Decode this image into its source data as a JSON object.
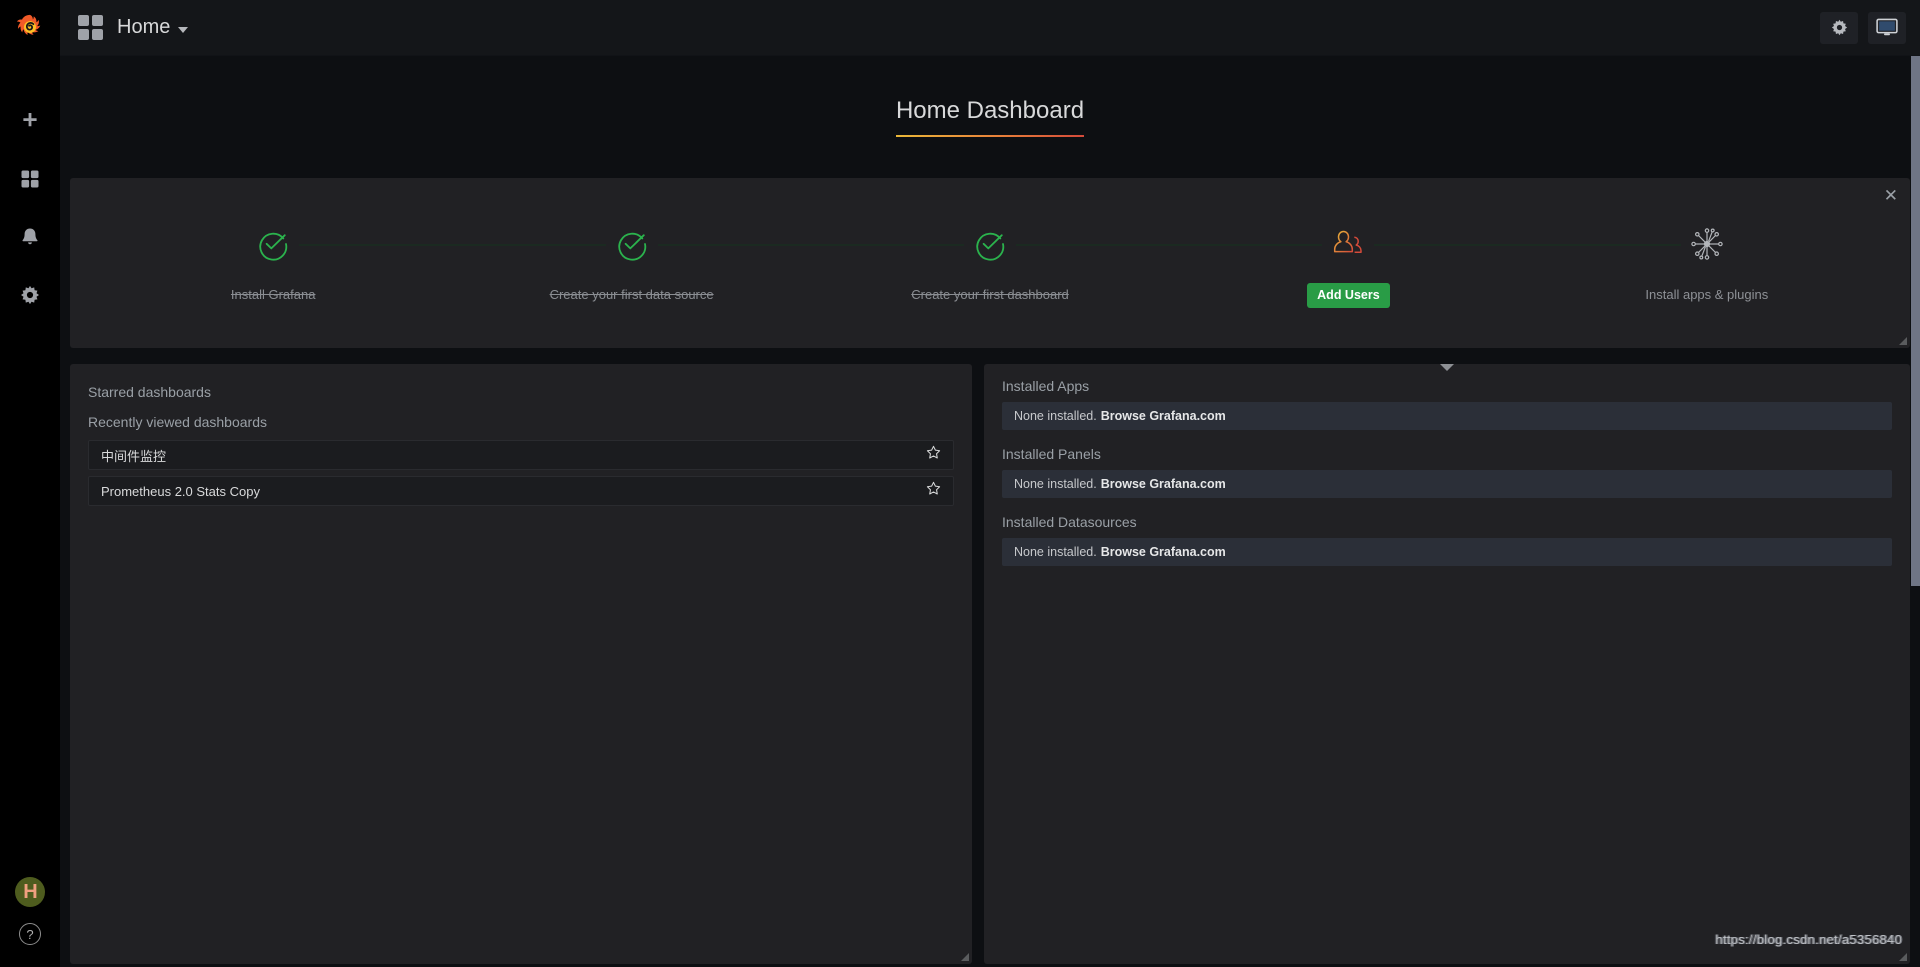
{
  "sidebar": {
    "brand_icon": "grafana-logo",
    "items": [
      {
        "name": "create",
        "icon": "plus-icon"
      },
      {
        "name": "dashboards",
        "icon": "apps-grid-icon"
      },
      {
        "name": "alerting",
        "icon": "bell-icon"
      },
      {
        "name": "configuration",
        "icon": "gear-icon"
      }
    ],
    "avatar_initial": "H",
    "help_label": "?"
  },
  "topnav": {
    "menu_icon": "apps-grid-icon",
    "title": "Home",
    "caret_icon": "chevron-down-icon",
    "actions": [
      {
        "name": "dashboard-settings",
        "icon": "gear-icon"
      },
      {
        "name": "tv-mode",
        "icon": "monitor-icon"
      }
    ]
  },
  "dashboard": {
    "title": "Home Dashboard"
  },
  "onboarding": {
    "close_label": "✕",
    "steps": [
      {
        "label": "Install Grafana",
        "state": "done",
        "icon": "check-circle-icon"
      },
      {
        "label": "Create your first data source",
        "state": "done",
        "icon": "check-circle-icon"
      },
      {
        "label": "Create your first dashboard",
        "state": "done",
        "icon": "check-circle-icon"
      },
      {
        "label": "Add Users",
        "state": "action",
        "icon": "users-icon",
        "button": "Add Users"
      },
      {
        "label": "Install apps & plugins",
        "state": "todo",
        "icon": "plugins-icon"
      }
    ]
  },
  "starred_panel": {
    "starred_title": "Starred dashboards",
    "recent_title": "Recently viewed dashboards",
    "items": [
      {
        "name": "中间件监控",
        "star_icon": "star-outline-icon"
      },
      {
        "name": "Prometheus 2.0 Stats Copy",
        "star_icon": "star-outline-icon"
      }
    ]
  },
  "plugins_panel": {
    "collapse_icon": "chevron-down-icon",
    "groups": [
      {
        "title": "Installed Apps",
        "empty_text": "None installed.",
        "link_text": "Browse Grafana.com"
      },
      {
        "title": "Installed Panels",
        "empty_text": "None installed.",
        "link_text": "Browse Grafana.com"
      },
      {
        "title": "Installed Datasources",
        "empty_text": "None installed.",
        "link_text": "Browse Grafana.com"
      }
    ]
  },
  "watermark": {
    "text": "https://blog.csdn.net/a5356840"
  },
  "colors": {
    "accent_orange": "#e8803a",
    "accent_yellow": "#eab839",
    "success_green": "#299c46",
    "check_green": "#2bb34d",
    "panel_bg": "#212124",
    "page_bg": "#0d0f12"
  }
}
